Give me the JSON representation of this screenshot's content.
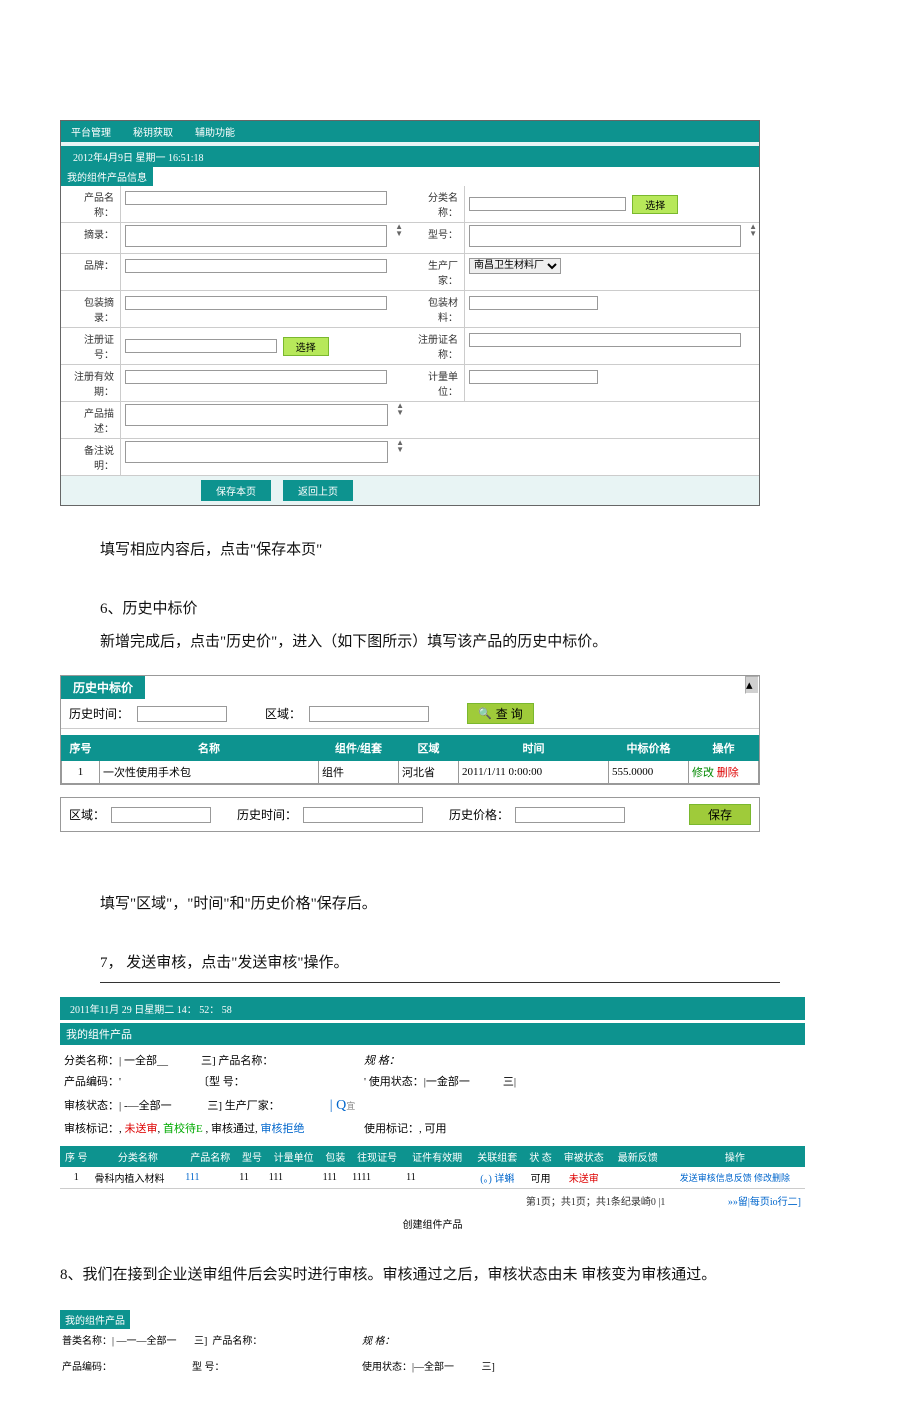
{
  "section1": {
    "nav": {
      "a": "平台管理",
      "b": "秘钥获取",
      "c": "辅助功能"
    },
    "datetime": "2012年4月9日 星期一 16:51:18",
    "panelTitle": "我的组件产品信息",
    "labels": {
      "productName": "产品名称：",
      "categoryName": "分类名称：",
      "abstract": "摘录：",
      "model": "型号：",
      "brand": "品牌：",
      "manufacturer": "生产厂家：",
      "packageAbstract": "包装摘录：",
      "packageMaterial": "包装材料：",
      "regCertNo": "注册证号：",
      "regCertName": "注册证名称：",
      "regValidity": "注册有效期：",
      "unit": "计量单位：",
      "productDesc": "产品描述：",
      "remark": "备注说明："
    },
    "selectBtn": "选择",
    "manufacturerOption": "南昌卫生材料厂",
    "buttons": {
      "save": "保存本页",
      "back": "返回上页"
    }
  },
  "text1": "填写相应内容后，点击\"保存本页\"",
  "text2a": "6、历史中标价",
  "text2b": "新增完成后，点击\"历史价\"，进入（如下图所示）填写该产品的历史中标价。",
  "section2": {
    "title": "历史中标价",
    "queryLabels": {
      "histTime": "历史时间：",
      "region": "区域："
    },
    "queryBtn": "查 询",
    "headers": {
      "seq": "序号",
      "name": "名称",
      "component": "组件/组套",
      "region": "区域",
      "time": "时间",
      "bidPrice": "中标价格",
      "ops": "操作"
    },
    "row": {
      "seq": "1",
      "name": "一次性使用手术包",
      "component": "组件",
      "region": "河北省",
      "time": "2011/1/11 0:00:00",
      "bidPrice": "555.0000"
    },
    "ops": {
      "modify": "修改",
      "del": "删除"
    },
    "saveLabels": {
      "region": "区域：",
      "histTime": "历史时间：",
      "histPrice": "历史价格："
    },
    "saveBtn": "保存"
  },
  "text3": "填写\"区域\"，\"时间\"和\"历史价格\"保存后。",
  "text4": "7，   发送审核，点击\"发送审核\"操作。",
  "section3": {
    "datetime": "2011年11月 29 日星期二 14： 52： 58",
    "panelTitle": "我的组件产品",
    "filters": {
      "l1a": "分类名称：| 一全部__            三] 产品名称：",
      "l1b": "规 格：",
      "l2a": "产品编码：'                            〔型 号：",
      "l2b": "' 使用状态：|一金部一            三|",
      "l3": "审核状态：| -―全部一             三] 生产厂家：",
      "legendPrefix": "审核标记：,",
      "legend1": "未送审",
      "legendSep1": ",",
      "legend2": "首校待E",
      "legendSep2": ", 审核通过,",
      "legend3": "审核拒绝",
      "useMark": "使用标记：, 可用"
    },
    "headers": {
      "seq": "序 号",
      "cat": "分类名称",
      "prod": "产品名称",
      "model": "型号",
      "unit": "计量单位",
      "pack": "包装",
      "reg": "往现证号",
      "cert": "证件有效期",
      "assoc": "关联组套",
      "status": "状 态",
      "audit": "审被状态",
      "feedback": "最新反馈",
      "ops": "操作"
    },
    "row": {
      "seq": "1",
      "cat": "骨科内植入材料",
      "prod": "111",
      "model": "11",
      "unit": "111",
      "pack": "111",
      "reg": "1111",
      "cert": "11",
      "valid": "",
      "assoc": "(。) 详蝌",
      "status": "可用",
      "audit": "未送审",
      "feedback": "",
      "ops": "发送审核信息反馈 修改删除"
    },
    "pager": "第1页；共1页；共1条纪录崎0 |1",
    "pagerR": "»»留|每页io行二]",
    "createLink": "创建组件产品"
  },
  "text5": "8、我们在接到企业送审组件后会实时进行审核。审核通过之后，审核状态由未 审核变为审核通过。",
  "section4": {
    "panelTitle": "我的组件产品",
    "l1a": "普类名称：| ―一―全部一       三]  产品名称：",
    "l1b": "规 格：",
    "l2a": "产品编码：                                型 号：",
    "l2b": "使用状态：|―全部一           三]"
  }
}
